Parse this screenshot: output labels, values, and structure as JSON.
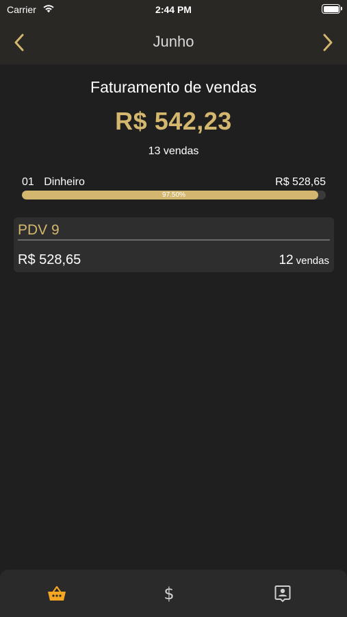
{
  "status_bar": {
    "carrier": "Carrier",
    "time": "2:44 PM"
  },
  "nav": {
    "title": "Junho",
    "prev_icon": "chevron-left-icon",
    "next_icon": "chevron-right-icon"
  },
  "summary": {
    "title": "Faturamento de vendas",
    "total": "R$ 542,23",
    "count": "13 vendas"
  },
  "payment_methods": [
    {
      "code": "01",
      "name": "Dinheiro",
      "value": "R$ 528,65",
      "percent_label": "97.50%",
      "percent": 97.5
    }
  ],
  "pdvs": [
    {
      "name": "PDV 9",
      "value": "R$ 528,65",
      "count": "12",
      "count_unit": "vendas"
    }
  ],
  "tabbar": {
    "tabs": [
      {
        "icon": "basket-icon",
        "active": true
      },
      {
        "icon": "dollar-icon",
        "glyph": "$",
        "active": false
      },
      {
        "icon": "contact-icon",
        "active": false
      }
    ]
  },
  "colors": {
    "accent": "#d4b76e",
    "active_tab": "#f5a623",
    "background": "#1f1f1f",
    "header": "#2a2824",
    "card": "#2e2e2e"
  }
}
